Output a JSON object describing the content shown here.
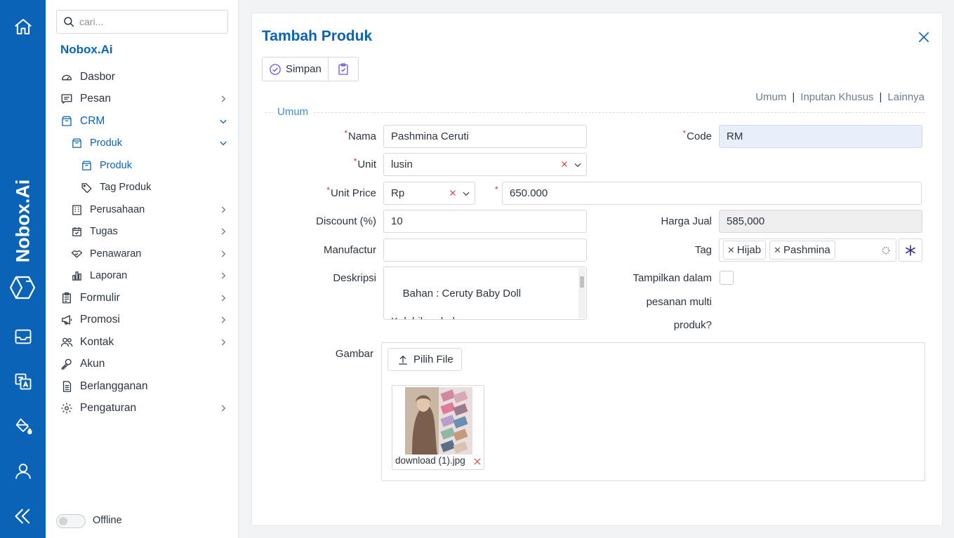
{
  "rail": {
    "brand": "Nobox.Ai",
    "icons": [
      "home-icon",
      "inbox-icon",
      "translate-icon",
      "paint-bucket-icon",
      "user-icon",
      "collapse-icon"
    ]
  },
  "sidebar": {
    "search_placeholder": "cari...",
    "brand": "Nobox.Ai",
    "items": [
      {
        "label": "Dasbor"
      },
      {
        "label": "Pesan"
      },
      {
        "label": "CRM"
      },
      {
        "label": "Produk"
      },
      {
        "label": "Produk"
      },
      {
        "label": "Tag Produk"
      },
      {
        "label": "Perusahaan"
      },
      {
        "label": "Tugas"
      },
      {
        "label": "Penawaran"
      },
      {
        "label": "Laporan"
      },
      {
        "label": "Formulir"
      },
      {
        "label": "Promosi"
      },
      {
        "label": "Kontak"
      },
      {
        "label": "Akun"
      },
      {
        "label": "Berlangganan"
      },
      {
        "label": "Pengaturan"
      }
    ],
    "offline_label": "Offline"
  },
  "form": {
    "title": "Tambah Produk",
    "save_label": "Simpan",
    "tabs": [
      "Umum",
      "Inputan Khusus",
      "Lainnya"
    ],
    "section_title": "Umum",
    "labels": {
      "nama": "Nama",
      "code": "Code",
      "unit": "Unit",
      "unit_price": "Unit Price",
      "discount": "Discount (%)",
      "harga_jual": "Harga Jual",
      "manufactur": "Manufactur",
      "tag": "Tag",
      "deskripsi": "Deskripsi",
      "tampilkan_1": "Tampilkan dalam",
      "tampilkan_2": "pesanan multi",
      "tampilkan_3": "produk?",
      "gambar": "Gambar"
    },
    "values": {
      "nama": "Pashmina Ceruti",
      "code": "RM",
      "unit": "lusin",
      "currency": "Rp",
      "price": "650.000",
      "discount": "10",
      "harga_jual": "585,000",
      "manufactur": "",
      "tags": [
        "Hijab",
        "Pashmina"
      ],
      "deskripsi": "Bahan : Ceruty Baby Doll\n\nKelebihan bahan :"
    },
    "pick_file_label": "Pilih File",
    "file_name": "download (1).jpg"
  }
}
